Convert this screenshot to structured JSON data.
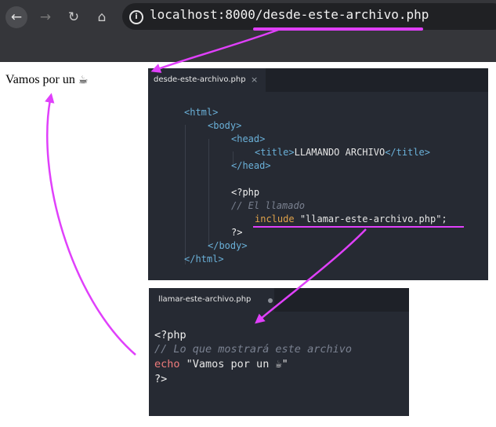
{
  "browser": {
    "nav": {
      "back": "←",
      "forward": "→",
      "reload": "↻",
      "home": "⌂"
    },
    "url": "localhost:8000/desde-este-archivo.php",
    "info_icon": "i"
  },
  "page": {
    "output_text": "Vamos por un",
    "emoji": "☕"
  },
  "editor1": {
    "tab_label": "desde-este-archivo.php",
    "tab_close": "×",
    "lines": {
      "l1_open": "<",
      "l1_tag": "html",
      "l1_close": ">",
      "l2_open": "<",
      "l2_tag": "body",
      "l2_close": ">",
      "l3_open": "<",
      "l3_tag": "head",
      "l3_close": ">",
      "l4_open": "<",
      "l4_tag": "title",
      "l4_close": ">",
      "l4_text": "LLAMANDO ARCHIVO",
      "l4_end_open": "</",
      "l4_end_tag": "title",
      "l4_end_close": ">",
      "l5_open": "</",
      "l5_tag": "head",
      "l5_close": ">",
      "l6": "<?php",
      "l7": "// El llamado",
      "l8_kw": "include",
      "l8_str": "\"llamar-este-archivo.php\";",
      "l9": "?>",
      "l10_open": "</",
      "l10_tag": "body",
      "l10_close": ">",
      "l11_open": "</",
      "l11_tag": "html",
      "l11_close": ">"
    }
  },
  "editor2": {
    "tab_label": "llamar-este-archivo.php",
    "lines": {
      "l1": "<?php",
      "l2": "// Lo que mostrará este archivo",
      "l3_kw": "echo",
      "l3_str": "\"Vamos por un ☕\"",
      "l4": "?>"
    }
  },
  "annotation_color": "#e040fb"
}
